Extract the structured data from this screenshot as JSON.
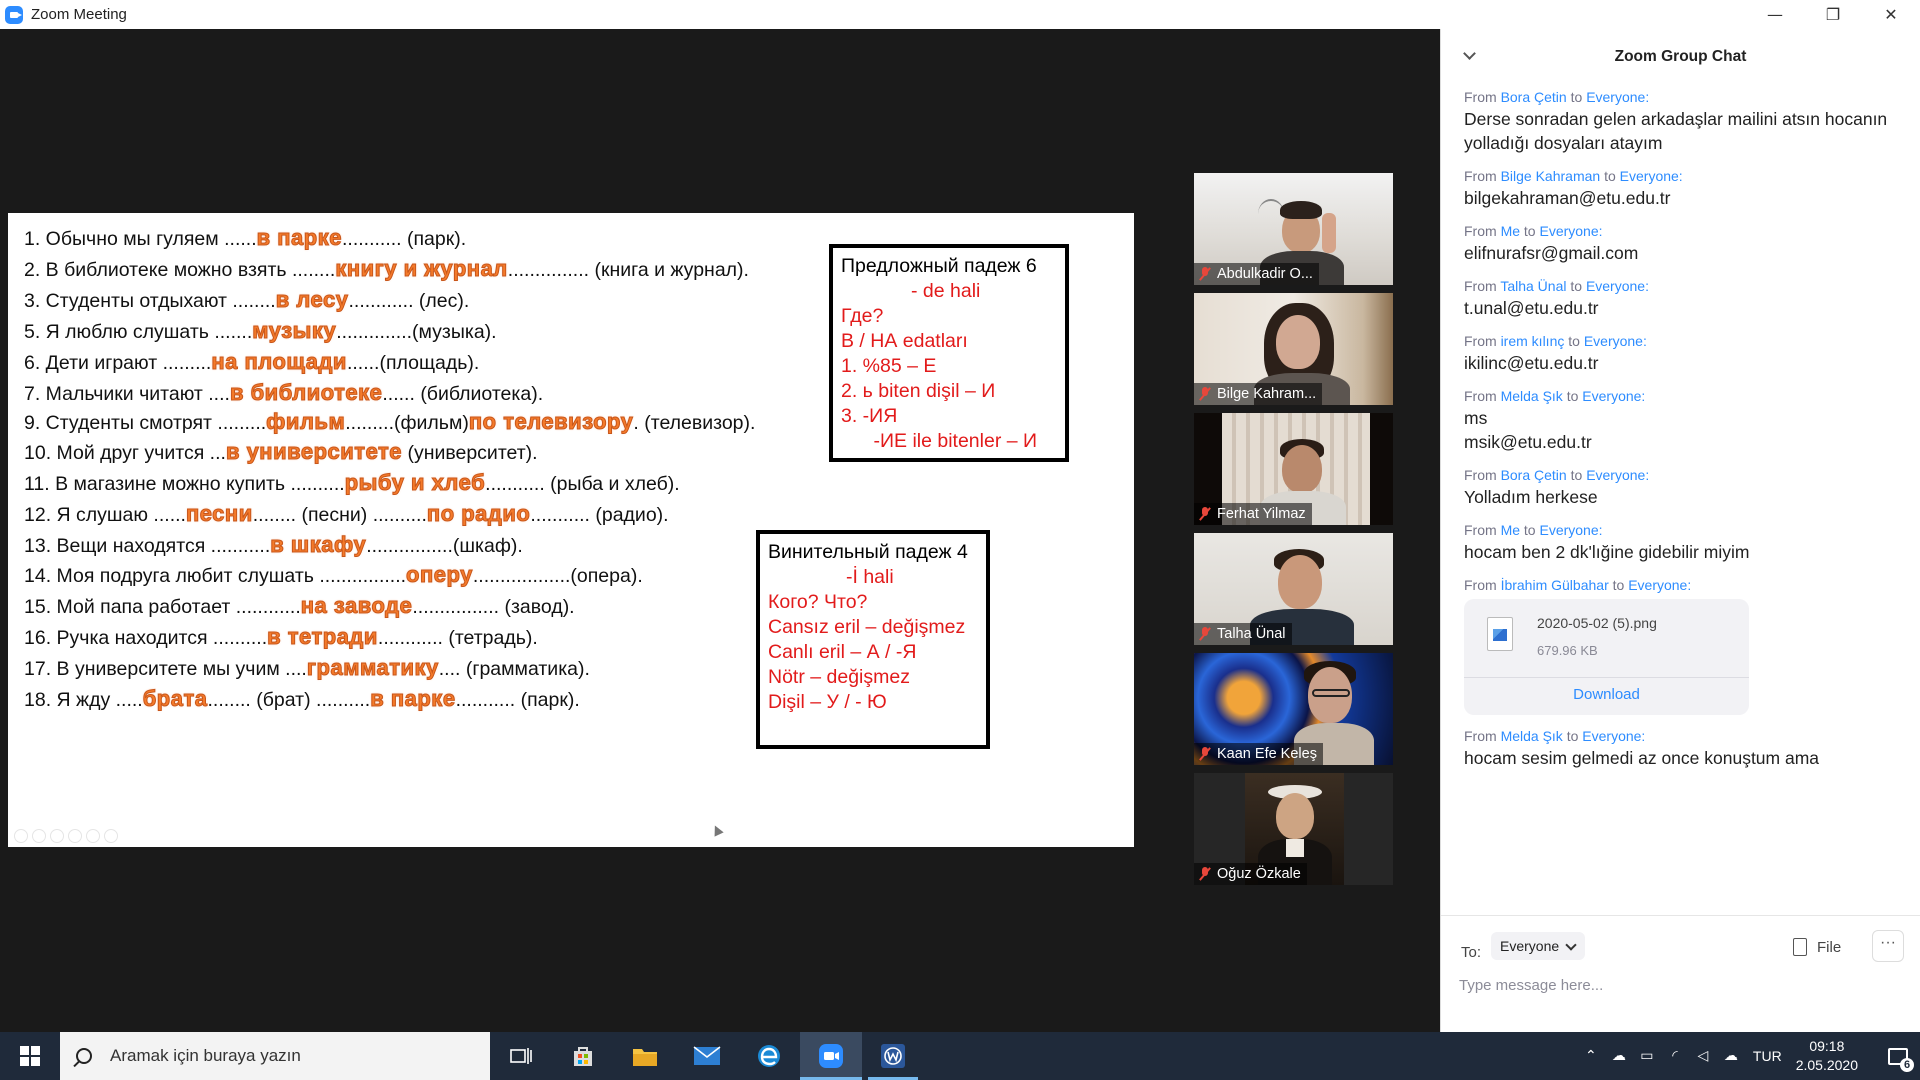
{
  "window": {
    "title": "Zoom Meeting",
    "minimize": "—",
    "restore": "❐",
    "close": "✕"
  },
  "slide": {
    "lines": [
      {
        "pre": "1. Обычно мы гуляем ......",
        "ans": "в парке",
        "post": "........... (парк)."
      },
      {
        "pre": "2. В библиотеке можно взять ........",
        "ans": "книгу и журнал",
        "post": "............... (книга и журнал)."
      },
      {
        "pre": "3. Студенты отдыхают ........",
        "ans": "в лесу",
        "post": "............ (лес)."
      },
      {
        "pre": "5. Я люблю слушать .......",
        "ans": "музыку",
        "post": "..............(музыка)."
      },
      {
        "pre": "6. Дети играют .........",
        "ans": "на площади",
        "post": "......(площадь)."
      },
      {
        "pre": "7. Мальчики читают ....",
        "ans": "в библиотеке",
        "post": "...... (библиотека)."
      },
      {
        "pre": "9. Студенты смотрят .........",
        "ans": "фильм",
        "post": ".........(фильм)",
        "ans2": "по телевизору",
        "post2": ". (телевизор)."
      },
      {
        "pre": "10. Мой друг учится ...",
        "ans": "в университете",
        "post": " (университет)."
      },
      {
        "pre": "11. В магазине можно купить ..........",
        "ans": "рыбу и хлеб",
        "post": "........... (рыба и хлеб)."
      },
      {
        "pre": "12. Я слушаю ......",
        "ans": "песни",
        "post": "........ (песни) ..........",
        "ans2": "по радио",
        "post2": "........... (радио)."
      },
      {
        "pre": "13. Вещи находятся ...........",
        "ans": "в шкафу",
        "post": "................(шкаф)."
      },
      {
        "pre": "14. Моя подруга любит слушать ................",
        "ans": "оперу",
        "post": "..................(опера)."
      },
      {
        "pre": "15. Мой папа работает ............",
        "ans": "на заводе",
        "post": "................ (завод)."
      },
      {
        "pre": "16. Ручка находится ..........",
        "ans": "в тетради",
        "post": "............ (тетрадь)."
      },
      {
        "pre": "17. В университете мы учим ....",
        "ans": "грамматику",
        "post": ".... (грамматика)."
      },
      {
        "pre": "18. Я жду .....",
        "ans": "брата",
        "post": "........ (брат) ..........",
        "ans2": "в парке",
        "post2": "........... (парк)."
      }
    ],
    "box1": {
      "header": "Предложный падеж 6",
      "lines": [
        "- de hali",
        "Где?",
        "В / НА edatları",
        "1.   %85 – E",
        "2.   ь biten dişil – И",
        "3.   -ИЯ",
        "      -ИЕ ile bitenler – И"
      ]
    },
    "box2": {
      "header": "Винительный падеж 4",
      "lines": [
        "-İ hali",
        "Кого? Что?",
        "Cansız eril – değişmez",
        "Canlı eril – А / -Я",
        "Nötr – değişmez",
        "Dişil – У / - Ю"
      ]
    }
  },
  "participants": [
    {
      "name": "Abdulkadir O..."
    },
    {
      "name": "Bilge Kahram..."
    },
    {
      "name": "Ferhat Yilmaz"
    },
    {
      "name": "Talha Ünal"
    },
    {
      "name": "Kaan Efe Keleş"
    },
    {
      "name": "Oğuz Özkale"
    }
  ],
  "chat": {
    "title": "Zoom Group Chat",
    "from_label": "From",
    "to_label": "to",
    "messages": [
      {
        "from": "Bora Çetin",
        "to": "Everyone:",
        "lines": [
          "Derse sonradan gelen arkadaşlar mailini atsın hocanın yolladığı dosyaları atayım"
        ]
      },
      {
        "from": "Bilge Kahraman",
        "to": "Everyone:",
        "lines": [
          "bilgekahraman@etu.edu.tr"
        ]
      },
      {
        "from": "Me",
        "to": "Everyone:",
        "lines": [
          "elifnurafsr@gmail.com"
        ]
      },
      {
        "from": "Talha Ünal",
        "to": "Everyone:",
        "lines": [
          "t.unal@etu.edu.tr"
        ]
      },
      {
        "from": "irem kılınç",
        "to": "Everyone:",
        "lines": [
          "ikilinc@etu.edu.tr"
        ]
      },
      {
        "from": "Melda Şık",
        "to": "Everyone:",
        "lines": [
          "ms",
          "msik@etu.edu.tr"
        ]
      },
      {
        "from": "Bora Çetin",
        "to": "Everyone:",
        "lines": [
          "Yolladım herkese"
        ]
      },
      {
        "from": "Me",
        "to": "Everyone:",
        "lines": [
          "hocam ben 2 dk'lığine gidebilir miyim"
        ]
      },
      {
        "from": "İbrahim Gülbahar",
        "to": "Everyone:",
        "file": {
          "name": "2020-05-02 (5).png",
          "size": "679.96 KB",
          "action": "Download"
        }
      },
      {
        "from": "Melda Şık",
        "to": "Everyone:",
        "lines": [
          "hocam sesim gelmedi az once konuştum ama"
        ]
      }
    ],
    "composer": {
      "to_label": "To:",
      "recipient": "Everyone",
      "file_label": "File",
      "more_label": "···",
      "placeholder": "Type message here..."
    }
  },
  "taskbar": {
    "search_placeholder": "Aramak için buraya yazın",
    "language": "TUR",
    "time": "09:18",
    "date": "2.05.2020",
    "notifications": "6"
  }
}
